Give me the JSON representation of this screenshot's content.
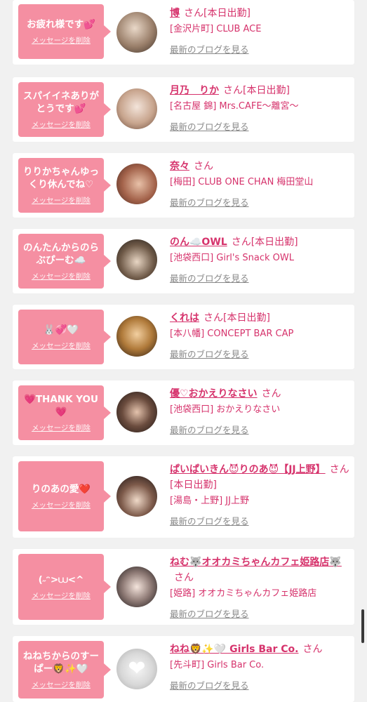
{
  "cards": [
    {
      "message": "お疲れ様です💕",
      "delete_label": "メッセージを削除",
      "name": "博",
      "san": "さん",
      "status": "[本日出勤]",
      "shop": "[金沢片町] CLUB ACE",
      "blog": "最新のブログを見る"
    },
    {
      "message": "スパイイネありがとうです💕",
      "delete_label": "メッセージを削除",
      "name": "月乃　りか",
      "san": "さん",
      "status": "[本日出勤]",
      "shop": "[名古屋 錦] Mrs.CAFE〜離宮〜",
      "blog": "最新のブログを見る"
    },
    {
      "message": "りりかちゃんゆっくり休んでね♡",
      "delete_label": "メッセージを削除",
      "name": "奈々",
      "san": "さん",
      "status": "",
      "shop": "[梅田] CLUB ONE CHAN 梅田堂山",
      "blog": "最新のブログを見る"
    },
    {
      "message": "のんたんからのらぶぴーむ☁️",
      "delete_label": "メッセージを削除",
      "name": "のん☁️OWL",
      "san": "さん",
      "status": "[本日出勤]",
      "shop": "[池袋西口] Girl's Snack OWL",
      "blog": "最新のブログを見る"
    },
    {
      "message": "🐰💞🤍",
      "delete_label": "メッセージを削除",
      "name": "くれは",
      "san": "さん",
      "status": "[本日出勤]",
      "shop": "[本八幡] CONCEPT BAR CAP",
      "blog": "最新のブログを見る"
    },
    {
      "message": "💗THANK YOU💗",
      "delete_label": "メッセージを削除",
      "name": "優♡おかえりなさい",
      "san": "さん",
      "status": "",
      "shop": "[池袋西口] おかえりなさい",
      "blog": "最新のブログを見る"
    },
    {
      "message": "りのあの愛❤️",
      "delete_label": "メッセージを削除",
      "name": "ぱいぱいきん😈りのあ😈【JJ上野】",
      "san": "さん",
      "status": "[本日出勤]",
      "shop": "[湯島・上野] JJ上野",
      "blog": "最新のブログを見る"
    },
    {
      "message": "(˶ᵔ>⩊<^",
      "delete_label": "メッセージを削除",
      "name": "ねむ🐺オオカミちゃんカフェ姫路店🐺",
      "san": "さん",
      "status": "",
      "shop": "[姫路] オオカミちゃんカフェ姫路店",
      "blog": "最新のブログを見る"
    },
    {
      "message": "ねねちからのすーぱー🦁✨🤍",
      "delete_label": "メッセージを削除",
      "name": "ねね🦁✨🤍 Girls Bar Co.",
      "san": "さん",
      "status": "",
      "shop": "[先斗町] Girls Bar Co.",
      "blog": "最新のブログを見る"
    }
  ],
  "colors": {
    "accent": "#d6336c",
    "bubble": "#f58fa2",
    "link_gray": "#888888",
    "background": "#f1f1f1"
  }
}
